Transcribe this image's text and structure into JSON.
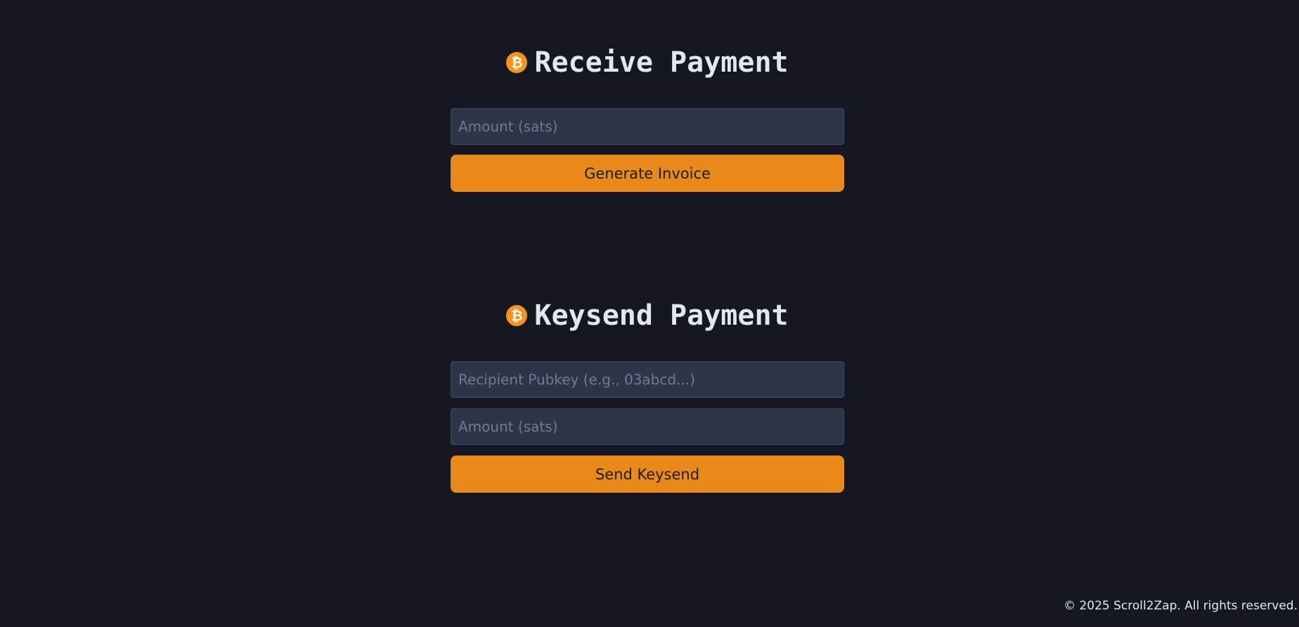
{
  "receive": {
    "title": "Receive Payment",
    "icon": "bitcoin-icon",
    "amount_placeholder": "Amount (sats)",
    "button_label": "Generate Invoice"
  },
  "keysend": {
    "title": "Keysend Payment",
    "icon": "bitcoin-icon",
    "pubkey_placeholder": "Recipient Pubkey (e.g., 03abcd...)",
    "amount_placeholder": "Amount (sats)",
    "button_label": "Send Keysend"
  },
  "footer": {
    "text": "© 2025 Scroll2Zap. All rights reserved."
  },
  "colors": {
    "background": "#151823",
    "accent": "#e8891a",
    "bitcoin": "#f7931a",
    "input": "#2d3648"
  }
}
